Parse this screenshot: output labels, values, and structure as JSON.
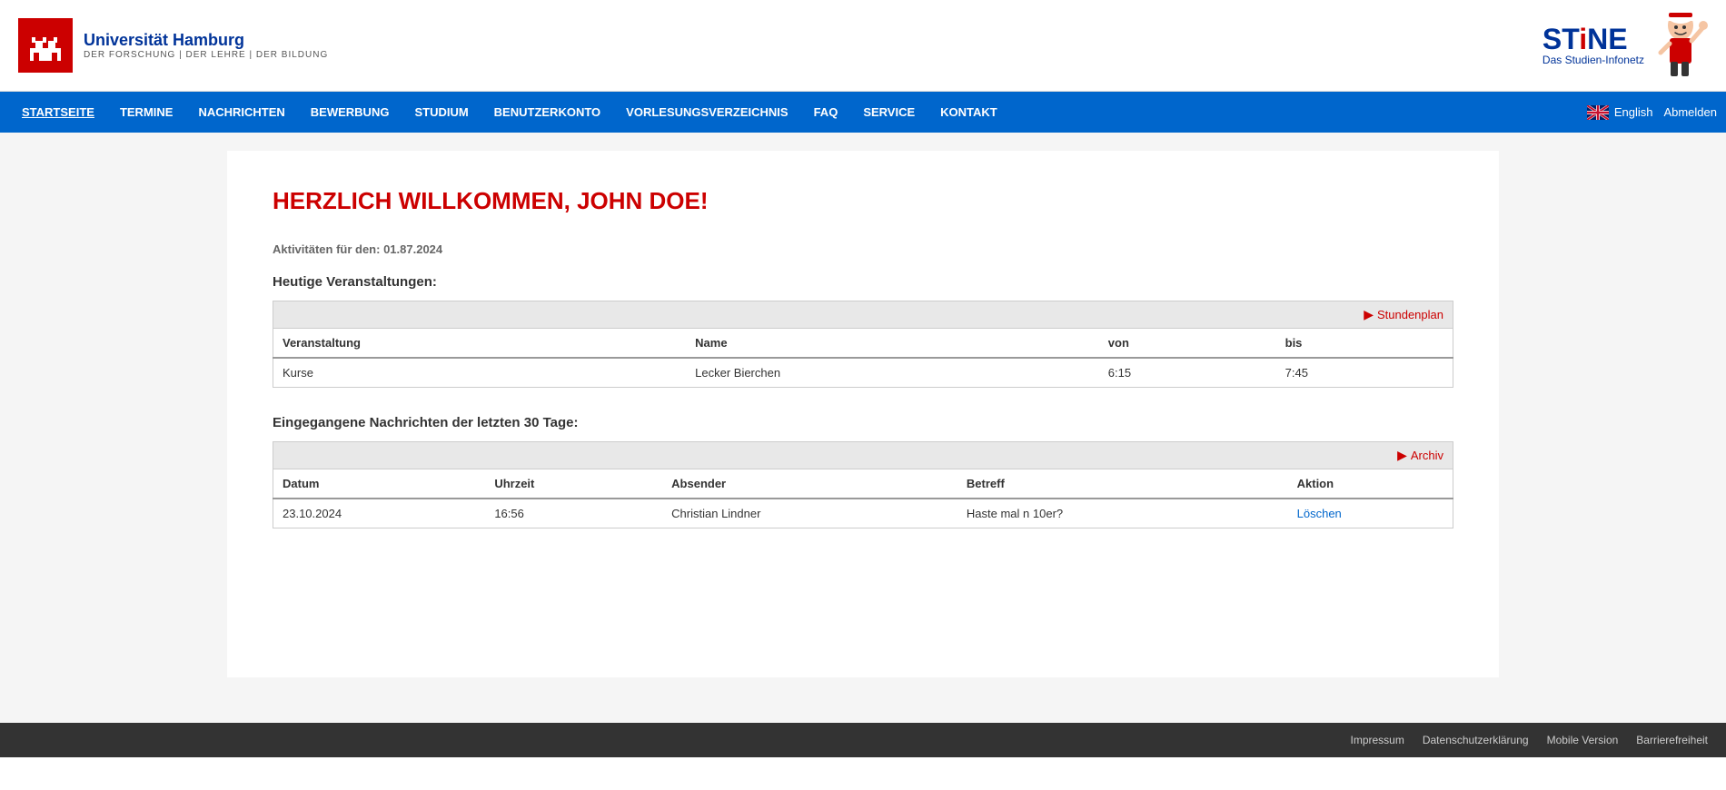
{
  "header": {
    "logo": {
      "university_name": "Universität Hamburg",
      "tagline": "DER FORSCHUNG | DER LEHRE | DER BILDUNG"
    },
    "stine": {
      "title_part1": "STi",
      "title_highlight": "N",
      "title_part2": "E",
      "subtitle": "Das Studien-Infonetz"
    }
  },
  "nav": {
    "items": [
      {
        "label": "STARTSEITE",
        "active": true
      },
      {
        "label": "TERMINE",
        "active": false
      },
      {
        "label": "NACHRICHTEN",
        "active": false
      },
      {
        "label": "BEWERBUNG",
        "active": false
      },
      {
        "label": "STUDIUM",
        "active": false
      },
      {
        "label": "BENUTZERKONTO",
        "active": false
      },
      {
        "label": "VORLESUNGSVERZEICHNIS",
        "active": false
      },
      {
        "label": "FAQ",
        "active": false
      },
      {
        "label": "SERVICE",
        "active": false
      },
      {
        "label": "KONTAKT",
        "active": false
      }
    ],
    "language": "English",
    "logout": "Abmelden"
  },
  "main": {
    "welcome_title": "HERZLICH WILLKOMMEN, JOHN DOE!",
    "activity_date_label": "Aktivitäten für den: 01.87.2024",
    "events_section": {
      "title": "Heutige Veranstaltungen:",
      "action_link": "Stundenplan",
      "table_headers": [
        "Veranstaltung",
        "Name",
        "von",
        "bis"
      ],
      "rows": [
        {
          "veranstaltung": "Kurse",
          "name": "Lecker Bierchen",
          "von": "6:15",
          "bis": "7:45"
        }
      ]
    },
    "messages_section": {
      "title": "Eingegangene Nachrichten der letzten 30 Tage:",
      "action_link": "Archiv",
      "table_headers": [
        "Datum",
        "Uhrzeit",
        "Absender",
        "Betreff",
        "Aktion"
      ],
      "rows": [
        {
          "datum": "23.10.2024",
          "uhrzeit": "16:56",
          "absender": "Christian Lindner",
          "betreff": "Haste mal n 10er?",
          "aktion": "Löschen"
        }
      ]
    }
  },
  "footer": {
    "links": [
      "Impressum",
      "Datenschutzerklärung",
      "Mobile Version",
      "Barrierefreiheit"
    ]
  }
}
